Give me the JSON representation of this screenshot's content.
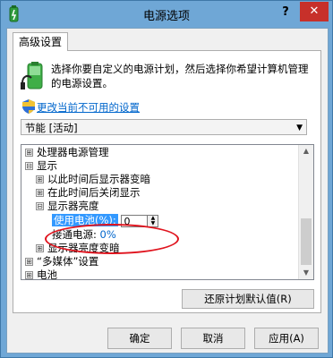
{
  "window": {
    "title": "电源选项",
    "help_label": "?",
    "close_label": "✕"
  },
  "tab": {
    "label": "高级设置"
  },
  "intro": {
    "text": "选择你要自定义的电源计划，然后选择你希望计算机管理的电源设置。"
  },
  "link": {
    "label": "更改当前不可用的设置"
  },
  "plan_select": {
    "value": "节能 [活动]"
  },
  "tree": {
    "items": [
      {
        "toggle": "⊞",
        "label": "处理器电源管理"
      },
      {
        "toggle": "⊟",
        "label": "显示"
      },
      {
        "toggle": "⊞",
        "label": "以此时间后显示器变暗"
      },
      {
        "toggle": "⊞",
        "label": "在此时间后关闭显示"
      },
      {
        "toggle": "⊟",
        "label": "显示器亮度"
      },
      {
        "label": "使用电池(%):",
        "value": "0"
      },
      {
        "label": "接通电源:",
        "value": "0%"
      },
      {
        "toggle": "⊞",
        "label": "显示器亮度变暗"
      },
      {
        "toggle": "⊞",
        "label": "“多媒体”设置"
      },
      {
        "toggle": "⊞",
        "label": "电池"
      }
    ]
  },
  "buttons": {
    "restore": "还原计划默认值(R)",
    "ok": "确定",
    "cancel": "取消",
    "apply": "应用(A)"
  },
  "colors": {
    "title_bar": "#6fa7d6",
    "close": "#c7302a",
    "selection": "#3399ff",
    "link": "#0066cc",
    "annotation": "#e0141e"
  }
}
